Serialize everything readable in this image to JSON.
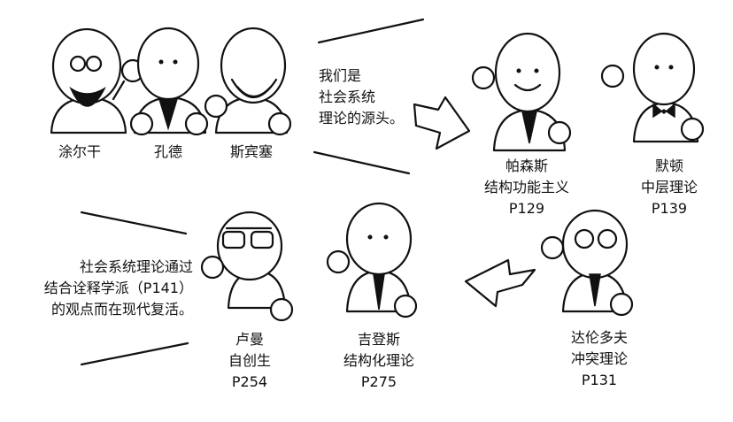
{
  "top_row": {
    "founders": [
      "涂尔干",
      "孔德",
      "斯宾塞"
    ],
    "founders_caption": [
      "我们是",
      "社会系统",
      "理论的源头。"
    ],
    "parsons": [
      "帕森斯",
      "结构功能主义",
      "P129"
    ],
    "merton": [
      "默顿",
      "中层理论",
      "P139"
    ]
  },
  "bottom_row": {
    "revival_caption": [
      "社会系统理论通过",
      "结合诠释学派（P141）",
      "的观点而在现代复活。"
    ],
    "luhmann": [
      "卢曼",
      "自创生",
      "P254"
    ],
    "giddens": [
      "吉登斯",
      "结构化理论",
      "P275"
    ],
    "dahrendorf": [
      "达伦多夫",
      "冲突理论",
      "P131"
    ]
  }
}
